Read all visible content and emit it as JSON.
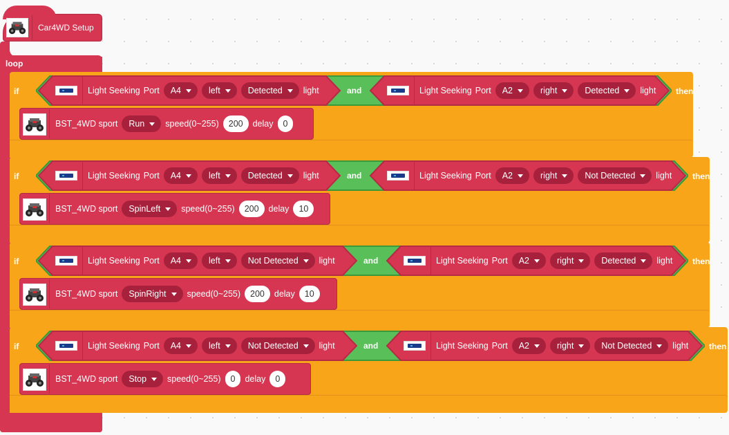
{
  "colors": {
    "setup": "#d63651",
    "if": "#f9a51a",
    "and": "#59c059",
    "dropdown": "#a8213c"
  },
  "setup": {
    "label": "Car4WD Setup",
    "icon": "car-robot-icon"
  },
  "loop": {
    "label": "loop"
  },
  "if_blocks": [
    {
      "kw": "if",
      "then": "then",
      "left": {
        "label": "Light Seeking",
        "port_label": "Port",
        "port": "A4",
        "side": "left",
        "state": "Detected",
        "light": "light"
      },
      "and": "and",
      "right": {
        "label": "Light Seeking",
        "port_label": "Port",
        "port": "A2",
        "side": "right",
        "state": "Detected",
        "light": "light"
      },
      "action": {
        "label": "BST_4WD sport",
        "mode": "Run",
        "speed_label": "speed(0~255)",
        "speed": "200",
        "delay_label": "delay",
        "delay": "0"
      }
    },
    {
      "kw": "if",
      "then": "then",
      "left": {
        "label": "Light Seeking",
        "port_label": "Port",
        "port": "A4",
        "side": "left",
        "state": "Detected",
        "light": "light"
      },
      "and": "and",
      "right": {
        "label": "Light Seeking",
        "port_label": "Port",
        "port": "A2",
        "side": "right",
        "state": "Not Detected",
        "light": "light"
      },
      "action": {
        "label": "BST_4WD sport",
        "mode": "SpinLeft",
        "speed_label": "speed(0~255)",
        "speed": "200",
        "delay_label": "delay",
        "delay": "10"
      }
    },
    {
      "kw": "if",
      "then": "then",
      "left": {
        "label": "Light Seeking",
        "port_label": "Port",
        "port": "A4",
        "side": "left",
        "state": "Not Detected",
        "light": "light"
      },
      "and": "and",
      "right": {
        "label": "Light Seeking",
        "port_label": "Port",
        "port": "A2",
        "side": "right",
        "state": "Detected",
        "light": "light"
      },
      "action": {
        "label": "BST_4WD sport",
        "mode": "SpinRight",
        "speed_label": "speed(0~255)",
        "speed": "200",
        "delay_label": "delay",
        "delay": "10"
      }
    },
    {
      "kw": "if",
      "then": "then",
      "left": {
        "label": "Light Seeking",
        "port_label": "Port",
        "port": "A4",
        "side": "left",
        "state": "Not Detected",
        "light": "light"
      },
      "and": "and",
      "right": {
        "label": "Light Seeking",
        "port_label": "Port",
        "port": "A2",
        "side": "right",
        "state": "Not Detected",
        "light": "light"
      },
      "action": {
        "label": "BST_4WD sport",
        "mode": "Stop",
        "speed_label": "speed(0~255)",
        "speed": "0",
        "delay_label": "delay",
        "delay": "0"
      }
    }
  ]
}
